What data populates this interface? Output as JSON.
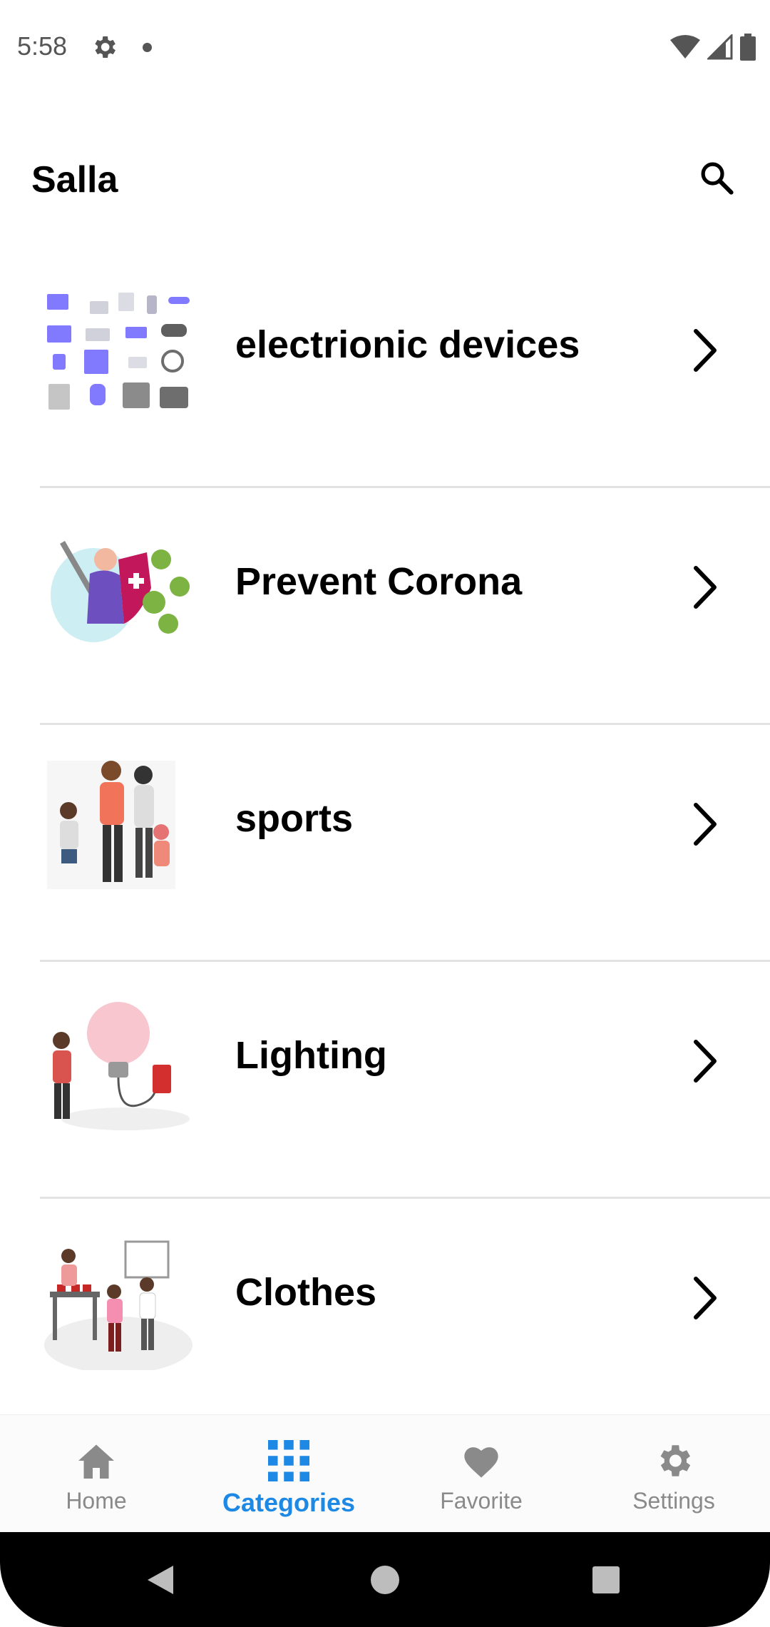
{
  "status_bar": {
    "time": "5:58"
  },
  "app_bar": {
    "title": "Salla"
  },
  "categories": [
    {
      "name": "electrionic devices",
      "image": "electronic-devices-illustration"
    },
    {
      "name": "Prevent Corona",
      "image": "prevent-corona-illustration"
    },
    {
      "name": "sports",
      "image": "sports-family-illustration"
    },
    {
      "name": "Lighting",
      "image": "lighting-bulb-illustration"
    },
    {
      "name": "Clothes",
      "image": "clothes-shop-illustration"
    }
  ],
  "bottom_nav": {
    "items": [
      {
        "label": "Home",
        "icon": "home-icon",
        "active": false
      },
      {
        "label": "Categories",
        "icon": "grid-icon",
        "active": true
      },
      {
        "label": "Favorite",
        "icon": "heart-icon",
        "active": false
      },
      {
        "label": "Settings",
        "icon": "gear-icon",
        "active": false
      }
    ]
  },
  "colors": {
    "accent": "#1e88e5",
    "inactive": "#8a8a8a",
    "divider": "#e3e3e3"
  }
}
